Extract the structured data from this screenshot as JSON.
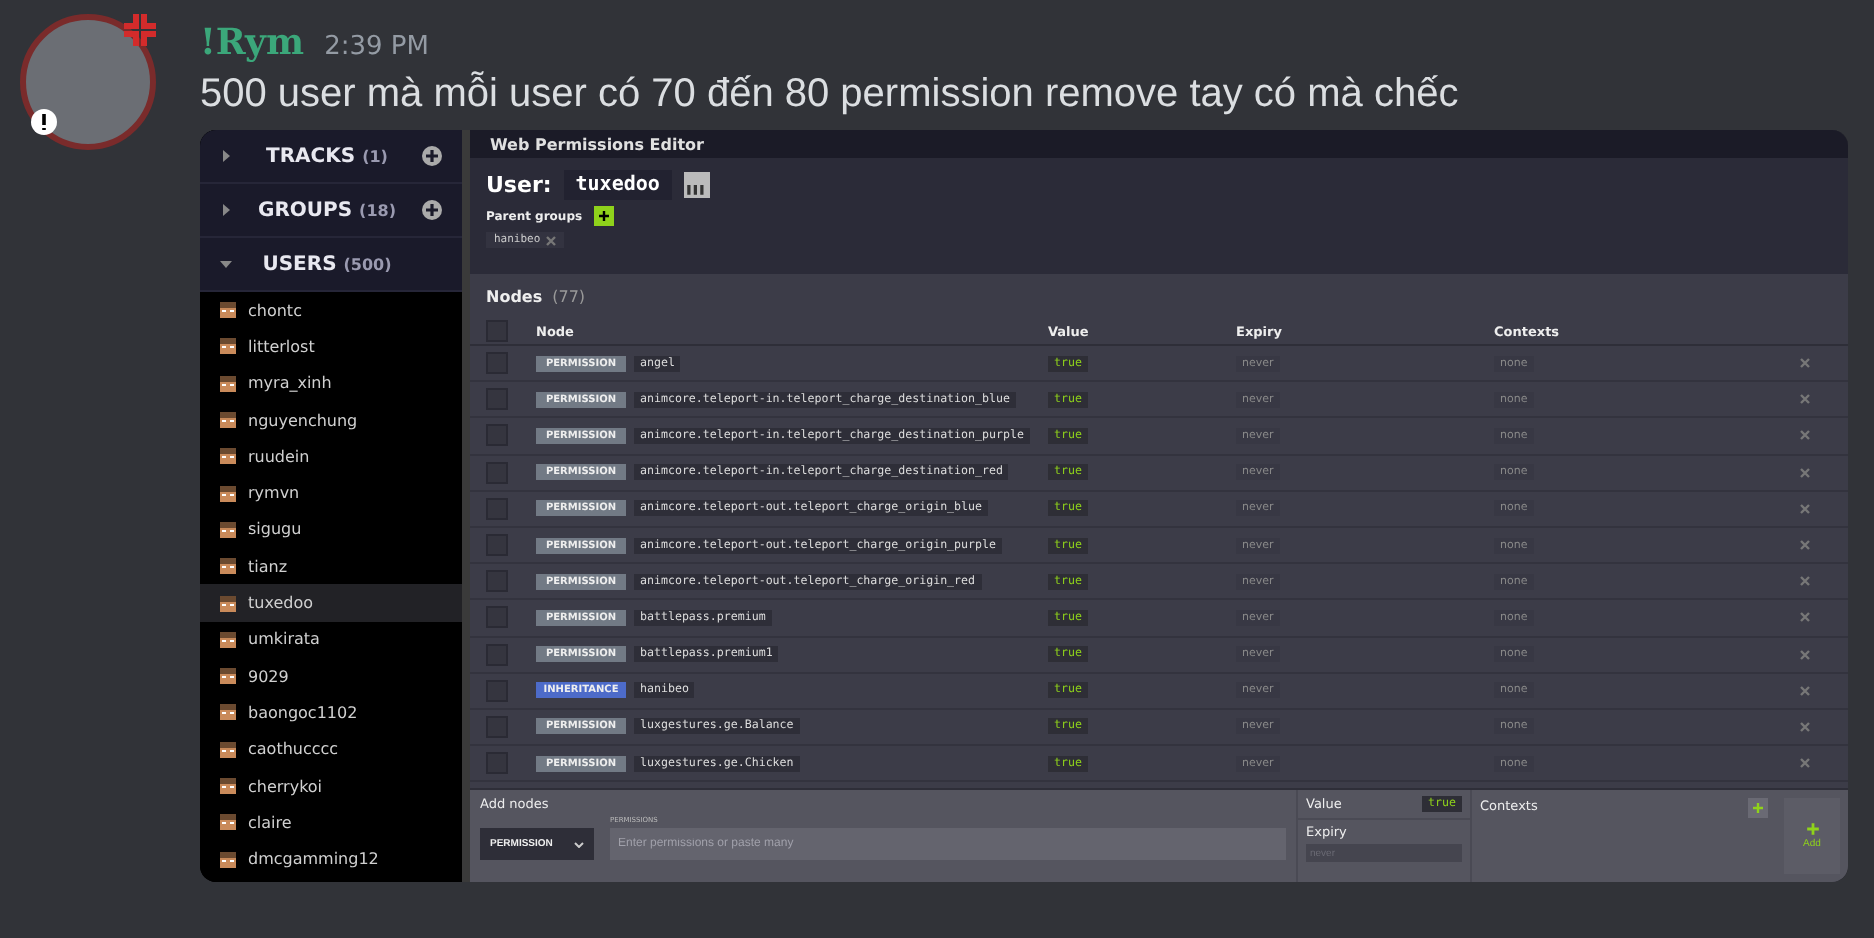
{
  "message": {
    "author": "!Rym",
    "time": "2:39 PM",
    "text": "500 user mà mỗi user có 70 đến 80 permission remove tay có mà chếc"
  },
  "editor": {
    "title": "Web Permissions Editor",
    "sidebar": {
      "sections": [
        {
          "label": "TRACKS",
          "count": "(1)",
          "expanded": false,
          "addable": true
        },
        {
          "label": "GROUPS",
          "count": "(18)",
          "expanded": false,
          "addable": true
        },
        {
          "label": "USERS",
          "count": "(500)",
          "expanded": true,
          "addable": false
        }
      ],
      "users": [
        {
          "name": "chontc",
          "selected": false
        },
        {
          "name": "litterlost",
          "selected": false
        },
        {
          "name": "myra_xinh",
          "selected": false
        },
        {
          "name": "nguyenchung",
          "selected": false
        },
        {
          "name": "ruudein",
          "selected": false
        },
        {
          "name": "rymvn",
          "selected": false
        },
        {
          "name": "sigugu",
          "selected": false
        },
        {
          "name": "tianz",
          "selected": false
        },
        {
          "name": "tuxedoo",
          "selected": true
        },
        {
          "name": "umkirata",
          "selected": false
        },
        {
          "name": "9029",
          "selected": false
        },
        {
          "name": "baongoc1102",
          "selected": false
        },
        {
          "name": "caothucccc",
          "selected": false
        },
        {
          "name": "cherrykoi",
          "selected": false
        },
        {
          "name": "claire",
          "selected": false
        },
        {
          "name": "dmcgamming12",
          "selected": false
        }
      ]
    },
    "user_label": "User:",
    "user_name": "tuxedoo",
    "parent_groups_label": "Parent groups",
    "parent_groups": [
      "hanibeo"
    ],
    "nodes_label": "Nodes",
    "nodes_count": "(77)",
    "columns": [
      "Node",
      "Value",
      "Expiry",
      "Contexts"
    ],
    "select_all_checked": false,
    "rows": [
      {
        "kind": "permission",
        "checked": false,
        "badge": "PERMISSION",
        "node": "angel",
        "value": "true",
        "expiry": "never",
        "contexts": "none"
      },
      {
        "kind": "permission",
        "checked": false,
        "badge": "PERMISSION",
        "node": "animcore.teleport-in.teleport_charge_destination_blue",
        "value": "true",
        "expiry": "never",
        "contexts": "none"
      },
      {
        "kind": "permission",
        "checked": false,
        "badge": "PERMISSION",
        "node": "animcore.teleport-in.teleport_charge_destination_purple",
        "value": "true",
        "expiry": "never",
        "contexts": "none"
      },
      {
        "kind": "permission",
        "checked": false,
        "badge": "PERMISSION",
        "node": "animcore.teleport-in.teleport_charge_destination_red",
        "value": "true",
        "expiry": "never",
        "contexts": "none"
      },
      {
        "kind": "permission",
        "checked": false,
        "badge": "PERMISSION",
        "node": "animcore.teleport-out.teleport_charge_origin_blue",
        "value": "true",
        "expiry": "never",
        "contexts": "none"
      },
      {
        "kind": "permission",
        "checked": false,
        "badge": "PERMISSION",
        "node": "animcore.teleport-out.teleport_charge_origin_purple",
        "value": "true",
        "expiry": "never",
        "contexts": "none"
      },
      {
        "kind": "permission",
        "checked": false,
        "badge": "PERMISSION",
        "node": "animcore.teleport-out.teleport_charge_origin_red",
        "value": "true",
        "expiry": "never",
        "contexts": "none"
      },
      {
        "kind": "permission",
        "checked": false,
        "badge": "PERMISSION",
        "node": "battlepass.premium",
        "value": "true",
        "expiry": "never",
        "contexts": "none"
      },
      {
        "kind": "permission",
        "checked": false,
        "badge": "PERMISSION",
        "node": "battlepass.premium1",
        "value": "true",
        "expiry": "never",
        "contexts": "none"
      },
      {
        "kind": "inheritance",
        "checked": false,
        "badge": "INHERITANCE",
        "node": "hanibeo",
        "value": "true",
        "expiry": "never",
        "contexts": "none"
      },
      {
        "kind": "permission",
        "checked": false,
        "badge": "PERMISSION",
        "node": "luxgestures.ge.Balance",
        "value": "true",
        "expiry": "never",
        "contexts": "none"
      },
      {
        "kind": "permission",
        "checked": false,
        "badge": "PERMISSION",
        "node": "luxgestures.ge.Chicken",
        "value": "true",
        "expiry": "never",
        "contexts": "none"
      }
    ],
    "add": {
      "label": "Add nodes",
      "type_select": "PERMISSION",
      "field_label": "PERMISSIONS",
      "placeholder": "Enter permissions or paste many",
      "value_label": "Value",
      "value": "true",
      "expiry_label": "Expiry",
      "expiry_placeholder": "never",
      "contexts_label": "Contexts",
      "button": "Add"
    }
  }
}
